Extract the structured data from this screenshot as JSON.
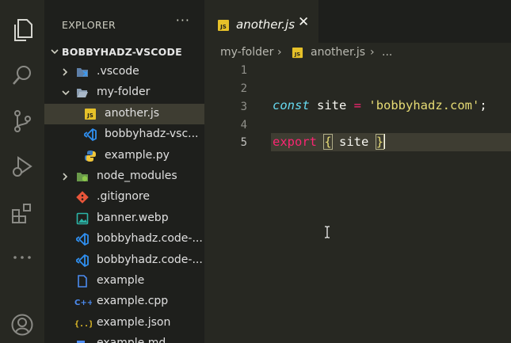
{
  "colors": {
    "accent": "#66d9ef",
    "keyword": "#f92672",
    "string": "#e6db74",
    "selection": "#3e3d32"
  },
  "sidebar": {
    "title": "EXPLORER",
    "more": "···",
    "root": "BOBBYHADZ-VSCODE",
    "items": [
      {
        "label": ".vscode",
        "icon": "vscode-folder-icon"
      },
      {
        "label": "my-folder",
        "icon": "folder-open-icon"
      },
      {
        "label": "another.js",
        "icon": "js-file-icon"
      },
      {
        "label": "bobbyhadz-vsc...",
        "icon": "vscode-file-icon"
      },
      {
        "label": "example.py",
        "icon": "python-file-icon"
      },
      {
        "label": "node_modules",
        "icon": "node-folder-icon"
      },
      {
        "label": ".gitignore",
        "icon": "git-file-icon"
      },
      {
        "label": "banner.webp",
        "icon": "image-file-icon"
      },
      {
        "label": "bobbyhadz.code-...",
        "icon": "vscode-file-icon"
      },
      {
        "label": "bobbyhadz.code-...",
        "icon": "vscode-file-icon"
      },
      {
        "label": "example",
        "icon": "file-icon"
      },
      {
        "label": "example.cpp",
        "icon": "cpp-file-icon"
      },
      {
        "label": "example.json",
        "icon": "json-file-icon"
      },
      {
        "label": "example.md",
        "icon": "markdown-file-icon"
      }
    ]
  },
  "tab": {
    "label": "another.js",
    "icon_text": "JS",
    "close": "✕"
  },
  "breadcrumb": {
    "folder": "my-folder",
    "sep": "›",
    "file": "another.js",
    "more": "..."
  },
  "editor": {
    "line_numbers": [
      "1",
      "2",
      "3",
      "4",
      "5"
    ],
    "line3": {
      "kw": "const",
      "name": " site ",
      "op": "=",
      "str": "'bobbyhadz.com'",
      "end": ";"
    },
    "line5": {
      "kw": "export",
      "open": "{",
      "name": " site ",
      "close": "}"
    }
  }
}
